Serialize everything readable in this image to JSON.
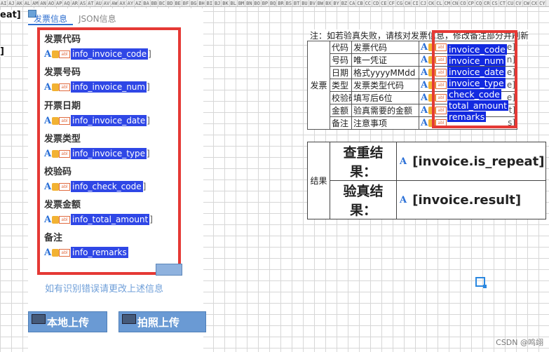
{
  "column_headers": [
    "AI",
    "AJ",
    "AK",
    "AL",
    "AM",
    "AN",
    "AO",
    "AP",
    "AQ",
    "AR",
    "AS",
    "AT",
    "AU",
    "AV",
    "AW",
    "AX",
    "AY",
    "AZ",
    "BA",
    "BB",
    "BC",
    "BD",
    "BE",
    "BF",
    "BG",
    "BH",
    "BI",
    "BJ",
    "BK",
    "BL",
    "BM",
    "BN",
    "BO",
    "BP",
    "BQ",
    "BR",
    "BS",
    "BT",
    "BU",
    "BV",
    "BW",
    "BX",
    "BY",
    "BZ",
    "CA",
    "CB",
    "CC",
    "CD",
    "CE",
    "CF",
    "CG",
    "CH",
    "CI",
    "CJ",
    "CK",
    "CL",
    "CM",
    "CN",
    "CO",
    "CP",
    "CQ",
    "CR",
    "CS",
    "CT",
    "CU",
    "CV",
    "CW",
    "CX",
    "CY"
  ],
  "left_edge": {
    "top": "eat]",
    "mid": "]"
  },
  "tabs": [
    {
      "label": "发票信息",
      "active": true
    },
    {
      "label": "JSON信息",
      "active": false
    }
  ],
  "fields": [
    {
      "label": "发票代码",
      "binding": "info_invoice_code",
      "trail": "]"
    },
    {
      "label": "发票号码",
      "binding": "info_invoice_num",
      "trail": "]"
    },
    {
      "label": "开票日期",
      "binding": "info_invoice_date",
      "trail": "]"
    },
    {
      "label": "发票类型",
      "binding": "info_invoice_type",
      "trail": "]"
    },
    {
      "label": "校验码",
      "binding": "info_check_code",
      "trail": "]"
    },
    {
      "label": "发票金额",
      "binding": "info_total_amount",
      "trail": "]"
    },
    {
      "label": "备注",
      "binding": "info_remarks",
      "trail": ""
    }
  ],
  "hint": "如有识别错误请更改上述信息",
  "buttons": {
    "local_upload": "本地上传",
    "photo_upload": "拍照上传"
  },
  "note": "注：如若验真失败，请核对发票信息，修改备注部分并刷新",
  "invoice_table": {
    "side_label": "发票",
    "rows": [
      {
        "key": "代码",
        "desc": "发票代码",
        "binding": "invoice_code",
        "trail": "e]"
      },
      {
        "key": "号码",
        "desc": "唯一凭证",
        "binding": "invoice_num",
        "trail": "n]"
      },
      {
        "key": "日期",
        "desc": "格式yyyyMMdd",
        "binding": "invoice_date",
        "trail": "e]"
      },
      {
        "key": "类型",
        "desc": "发票类型代码",
        "binding": "invoice_type",
        "trail": "e]"
      },
      {
        "key": "校验码",
        "desc": "填写后6位",
        "binding": "check_code",
        "trail": "e]"
      },
      {
        "key": "金额",
        "desc": "验真需要的金额",
        "binding": "total_amount",
        "trail": "t]"
      },
      {
        "key": "备注",
        "desc": "注意事项",
        "binding": "remarks",
        "trail": "s]"
      }
    ]
  },
  "result_table": {
    "side_label": "结果",
    "rows": [
      {
        "label": "查重结果：",
        "value": "[invoice.is_repeat]"
      },
      {
        "label": "验真结果：",
        "value": "[invoice.result]"
      }
    ]
  },
  "watermark": "CSDN @鸣翊"
}
